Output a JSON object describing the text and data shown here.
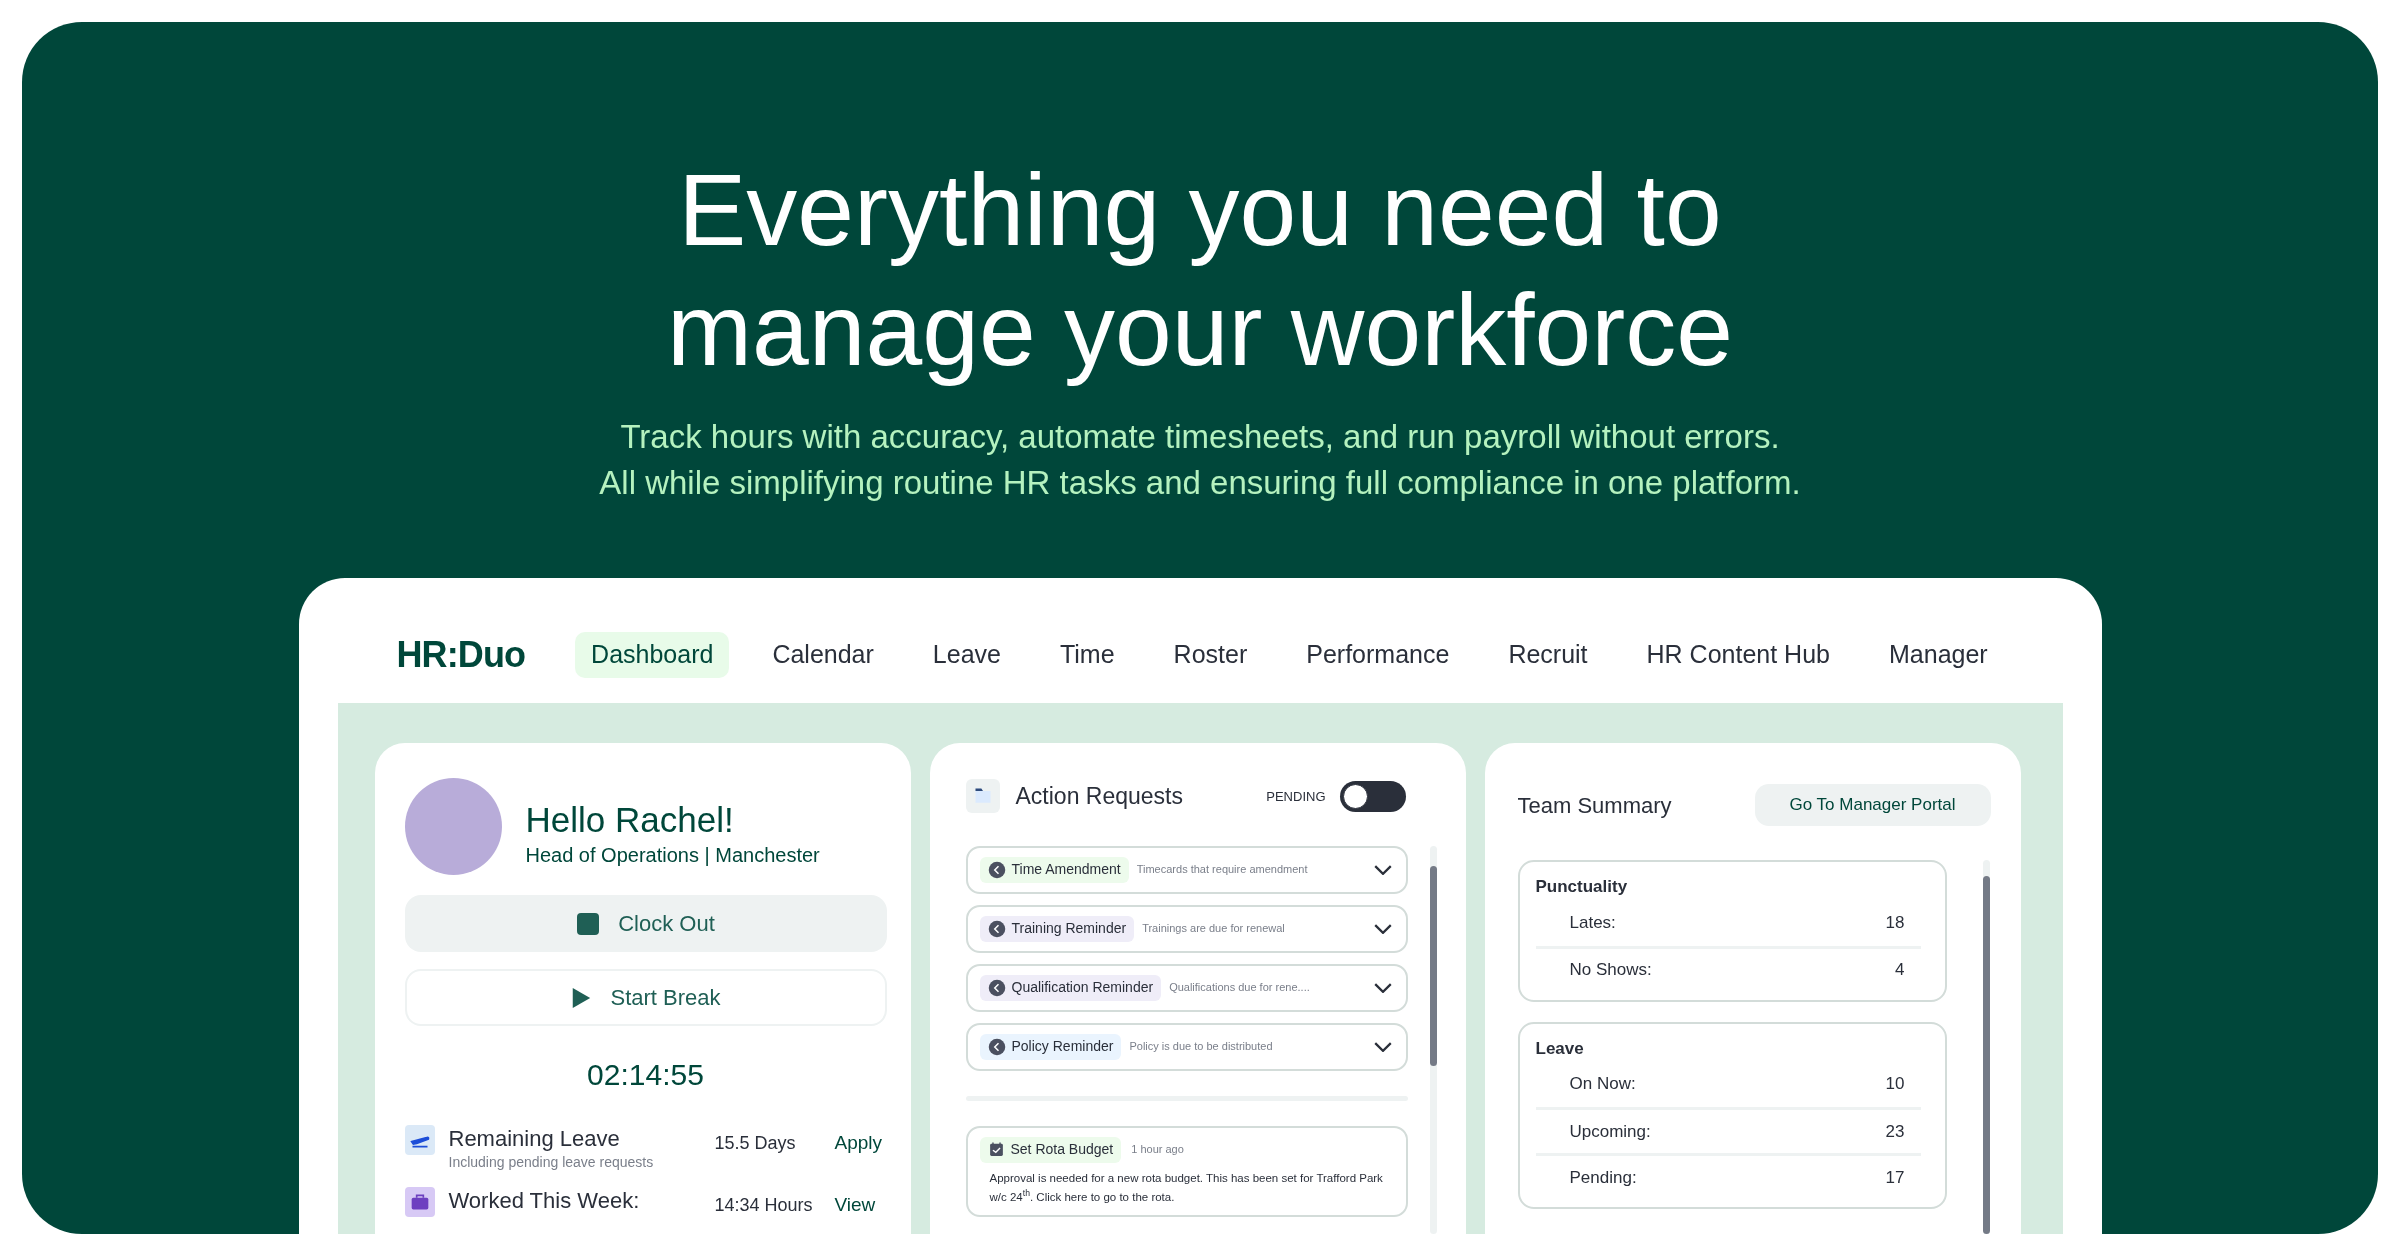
{
  "hero": {
    "title_lines": [
      "Everything you need to",
      "manage your workforce"
    ],
    "subtitle_lines": [
      "Track hours with accuracy, automate timesheets, and run payroll without errors.",
      "All while simplifying routine HR tasks and ensuring full compliance in one platform."
    ]
  },
  "nav": {
    "logo": "HR:Duo",
    "items": [
      {
        "label": "Dashboard",
        "selected": true
      },
      {
        "label": "Calendar",
        "selected": false
      },
      {
        "label": "Leave",
        "selected": false
      },
      {
        "label": "Time",
        "selected": false
      },
      {
        "label": "Roster",
        "selected": false
      },
      {
        "label": "Performance",
        "selected": false
      },
      {
        "label": "Recruit",
        "selected": false
      },
      {
        "label": "HR Content Hub",
        "selected": false
      },
      {
        "label": "Manager",
        "selected": false
      }
    ]
  },
  "profile": {
    "greeting": "Hello Rachel!",
    "role": "Head of Operations | Manchester",
    "clock_out": "Clock Out",
    "start_break": "Start Break",
    "timer": "02:14:55",
    "stats": [
      {
        "kind": "leave",
        "title": "Remaining Leave",
        "note": "Including pending leave requests",
        "value": "15.5 Days",
        "action": "Apply"
      },
      {
        "kind": "hours",
        "title": "Worked This Week:",
        "value": "14:34 Hours",
        "action": "View"
      }
    ]
  },
  "action_requests": {
    "title": "Action Requests",
    "filter_label": "PENDING",
    "filter_on": false,
    "items": [
      {
        "label": "Time Amendment",
        "description": "Timecards that require amendment",
        "color": "#edfbec"
      },
      {
        "label": "Training Reminder",
        "description": "Trainings are due for renewal",
        "color": "#efedf8"
      },
      {
        "label": "Qualification Reminder",
        "description": "Qualifications due for rene....",
        "color": "#efedf8"
      },
      {
        "label": "Policy Reminder",
        "description": "Policy is due to be distributed",
        "color": "#eaf4fe"
      }
    ],
    "notification": {
      "title": "Set Rota Budget",
      "time": "1 hour ago",
      "body": "Approval is needed for a new rota budget. This has been set for Trafford Park w/c 24$^{th}$. Click here to go to the rota."
    }
  },
  "team_summary": {
    "title": "Team Summary",
    "button": "Go To Manager Portal",
    "groups": [
      {
        "title": "Punctuality",
        "rows": [
          {
            "label": "Lates:",
            "value": "18"
          },
          {
            "label": "No Shows:",
            "value": "4"
          }
        ]
      },
      {
        "title": "Leave",
        "rows": [
          {
            "label": "On Now:",
            "value": "10"
          },
          {
            "label": "Upcoming:",
            "value": "23"
          },
          {
            "label": "Pending:",
            "value": "17"
          }
        ]
      }
    ]
  }
}
